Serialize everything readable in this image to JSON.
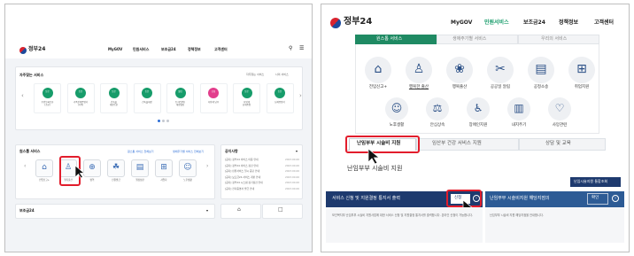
{
  "left": {
    "logo": "정부24",
    "nav": [
      "MyGOV",
      "민원서비스",
      "보조금24",
      "정책정보",
      "고객센터"
    ],
    "frequent": {
      "title": "자주찾는 서비스",
      "options": [
        "자주찾는 서비스",
        "나의 서비스"
      ],
      "items": [
        {
          "badge": "등본",
          "label": "주민등록등본\n(초본)"
        },
        {
          "badge": "등본",
          "label": "가족관계증명서\n(가족)"
        },
        {
          "badge": "등본",
          "label": "건축물\n대장등본"
        },
        {
          "badge": "등본",
          "label": "건축물대장"
        },
        {
          "badge": "열람",
          "label": "토지(임야)\n대장열람"
        },
        {
          "badge": "신청",
          "label": "지방세 납부"
        },
        {
          "badge": "등본",
          "label": "지방세\n납세증명"
        },
        {
          "badge": "등본",
          "label": "납세증명서"
        }
      ]
    },
    "lifecycle": {
      "title": "원스톱 서비스",
      "links": [
        "원스톱 서비스 전체보기",
        "생애주기별 서비스 전체보기"
      ],
      "items": [
        "전입신고+",
        "행복출산",
        "병역",
        "민원발급",
        "행정심판",
        "사업자",
        "노후생활"
      ]
    },
    "notice": {
      "title": "공지사항",
      "rows": [
        {
          "text": "[공지] 정부24 서비스 이용 안내",
          "date": "2023.00.00"
        },
        {
          "text": "[공지] 정부24 서비스 점검 안내",
          "date": "2023.00.00"
        },
        {
          "text": "[공지] 민원서비스 일시 중단 안내",
          "date": "2023.00.00"
        },
        {
          "text": "[공지] 보조금24 서비스 개편 안내",
          "date": "2023.00.00"
        },
        {
          "text": "[공지] 정부24 시스템 정기점검 안내",
          "date": "2023.00.00"
        },
        {
          "text": "[공지] 전자증명서 발급 안내",
          "date": "2023.00.00"
        }
      ]
    },
    "subsidy": {
      "title": "보조금24"
    }
  },
  "right": {
    "logo": "정부24",
    "nav": [
      "MyGOV",
      "민원서비스",
      "보조금24",
      "정책정보",
      "고객센터"
    ],
    "tabs_top": [
      "원스톱 서비스",
      "생애주기별 서비스",
      "우리의 서비스"
    ],
    "icons_row1": [
      "전입신고+",
      "행복한 출산",
      "행복출산",
      "공공일 알림",
      "공정소송",
      "취업지원"
    ],
    "icons_row2": [
      "노후생활",
      "안심상속",
      "장애인지원",
      "내지주기",
      "사망관련"
    ],
    "sub_tabs": [
      "난임부부 시술비 지원",
      "임산부 건강 서비스 지원",
      "상담 및 교육"
    ],
    "section_title": "난임부부 시술비 지원",
    "top_button": "난임시술지원 통합조회",
    "card1": {
      "title": "서비스 신청 및 지원결정 통지서 출력",
      "button": "신청",
      "desc": "보건복지부 난임부부 시술비 지원사업에 대한 서비스 신청 및 지원결정 통지서를 출력합니다. 온라인 신청이 가능합니다."
    },
    "card2": {
      "title": "난임부부 시술비지원 해당지점의",
      "button": "확인",
      "desc": "난임부부 시술비 지원 해당지점을 안내합니다."
    }
  }
}
